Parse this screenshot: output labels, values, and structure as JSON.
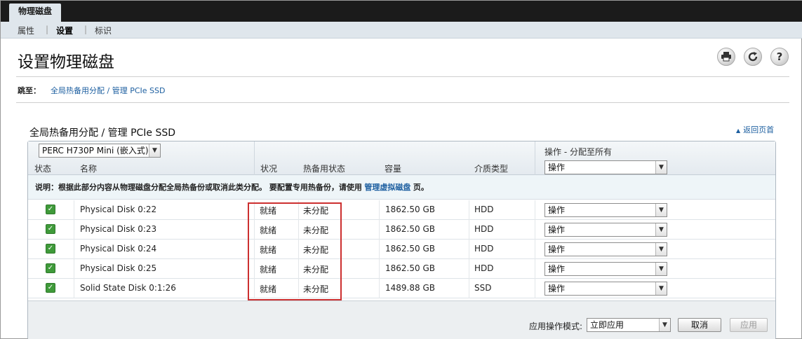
{
  "top_tab": "物理磁盘",
  "subnav": {
    "items": [
      "属性",
      "设置",
      "标识"
    ],
    "active": "设置"
  },
  "page_title": "设置物理磁盘",
  "toolbar_icons": [
    "print-icon",
    "refresh-icon",
    "help-icon"
  ],
  "jump": {
    "label": "跳至：",
    "link": "全局热备用分配 / 管理 PCIe SSD"
  },
  "section": {
    "title": "全局热备用分配 / 管理 PCIe SSD",
    "back_to_top": "返回页首"
  },
  "controller_select": "PERC H730P Mini (嵌入式)",
  "bulk": {
    "label": "操作 - 分配至所有",
    "select": "操作"
  },
  "columns": {
    "status": "状态",
    "name": "名称",
    "state": "状况",
    "hotspare": "热备用状态",
    "capacity": "容量",
    "media": "介质类型"
  },
  "note": {
    "prefix": "说明：根据此部分内容从物理磁盘分配全局热备份或取消此类分配。 要配置专用热备份，请使用",
    "link": "管理虚拟磁盘",
    "suffix": "页。"
  },
  "rows": [
    {
      "name": "Physical Disk 0:22",
      "state": "就绪",
      "hotspare": "未分配",
      "capacity": "1862.50 GB",
      "media": "HDD",
      "action": "操作"
    },
    {
      "name": "Physical Disk 0:23",
      "state": "就绪",
      "hotspare": "未分配",
      "capacity": "1862.50 GB",
      "media": "HDD",
      "action": "操作"
    },
    {
      "name": "Physical Disk 0:24",
      "state": "就绪",
      "hotspare": "未分配",
      "capacity": "1862.50 GB",
      "media": "HDD",
      "action": "操作"
    },
    {
      "name": "Physical Disk 0:25",
      "state": "就绪",
      "hotspare": "未分配",
      "capacity": "1862.50 GB",
      "media": "HDD",
      "action": "操作"
    },
    {
      "name": "Solid State Disk 0:1:26",
      "state": "就绪",
      "hotspare": "未分配",
      "capacity": "1489.88 GB",
      "media": "SSD",
      "action": "操作"
    }
  ],
  "footer": {
    "mode_label": "应用操作模式:",
    "mode_value": "立即应用",
    "cancel": "取消",
    "apply": "应用"
  },
  "colors": {
    "highlight": "#cc2f2f",
    "status_ok": "#3f9a3a",
    "link": "#1d5fa0"
  }
}
